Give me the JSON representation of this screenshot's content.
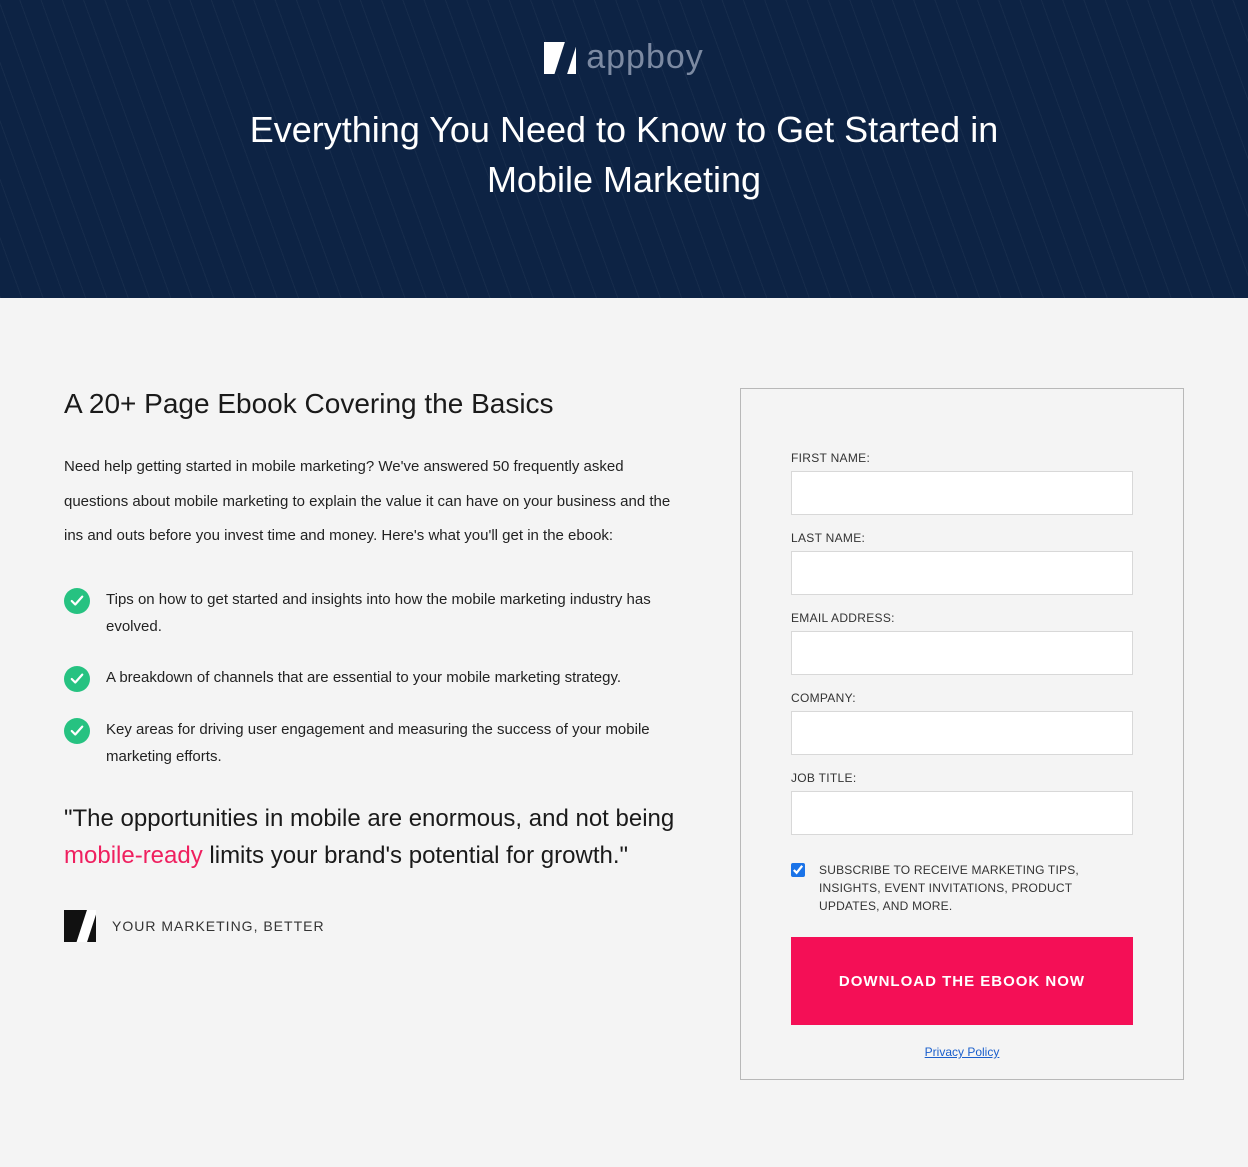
{
  "brand": {
    "name": "appboy",
    "tagline": "YOUR MARKETING, BETTER"
  },
  "hero": {
    "title": "Everything You Need to Know to Get Started in Mobile Marketing"
  },
  "content": {
    "subtitle": "A 20+ Page Ebook Covering the Basics",
    "intro": "Need help getting started in mobile marketing? We've answered 50 frequently asked questions about mobile marketing to explain the value it can have on your business and the ins and outs before you invest time and money. Here's what you'll get in the ebook:",
    "bullets": [
      "Tips on how to get started and insights into how the mobile marketing industry has evolved.",
      "A breakdown of channels that are essential to your mobile marketing strategy.",
      "Key areas for driving user engagement and measuring the success of your mobile marketing efforts."
    ],
    "quote_pre": "\"The opportunities in mobile are enormous, and not being ",
    "quote_highlight": "mobile-ready",
    "quote_post": " limits your brand's potential for growth.\""
  },
  "form": {
    "fields": [
      {
        "label": "FIRST NAME:",
        "value": ""
      },
      {
        "label": "LAST NAME:",
        "value": ""
      },
      {
        "label": "EMAIL ADDRESS:",
        "value": ""
      },
      {
        "label": "COMPANY:",
        "value": ""
      },
      {
        "label": "JOB TITLE:",
        "value": ""
      }
    ],
    "subscribe_label": "SUBSCRIBE TO RECEIVE MARKETING TIPS, INSIGHTS, EVENT INVITATIONS, PRODUCT UPDATES, AND MORE.",
    "subscribe_checked": true,
    "submit_label": "DOWNLOAD THE EBOOK NOW",
    "privacy_label": "Privacy Policy"
  },
  "colors": {
    "hero_bg": "#0d2344",
    "accent_green": "#26c281",
    "accent_pink": "#ef1f5f",
    "button_pink": "#f40f56"
  }
}
